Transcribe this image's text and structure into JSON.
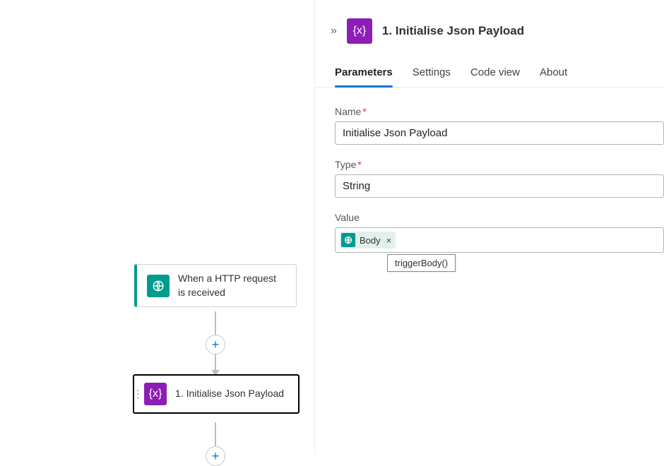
{
  "canvas": {
    "trigger": {
      "label": "When a HTTP request is received",
      "icon_name": "http-icon"
    },
    "action": {
      "label": "1. Initialise Json Payload",
      "icon_name": "variable-icon",
      "icon_glyph": "{x}"
    }
  },
  "panel": {
    "title": "1. Initialise Json Payload",
    "icon_glyph": "{x}",
    "tabs": [
      {
        "label": "Parameters",
        "active": true
      },
      {
        "label": "Settings",
        "active": false
      },
      {
        "label": "Code view",
        "active": false
      },
      {
        "label": "About",
        "active": false
      }
    ],
    "fields": {
      "name": {
        "label": "Name",
        "required": true,
        "value": "Initialise Json Payload"
      },
      "type": {
        "label": "Type",
        "required": true,
        "value": "String"
      },
      "value": {
        "label": "Value",
        "required": false,
        "token": {
          "label": "Body",
          "expression": "triggerBody()"
        }
      }
    }
  }
}
